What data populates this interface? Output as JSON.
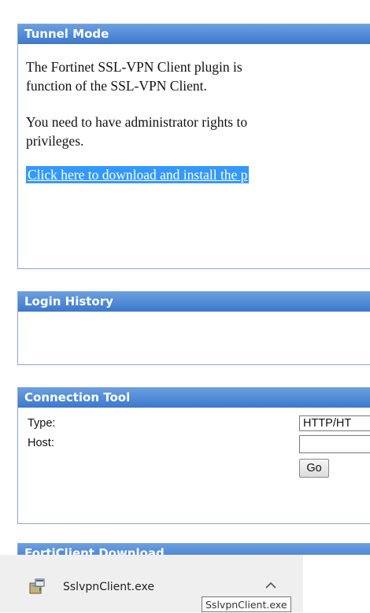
{
  "tunnel_mode": {
    "title": "Tunnel Mode",
    "line1": "The Fortinet SSL-VPN Client plugin is",
    "line2": "function of the SSL-VPN Client.",
    "line3": "You need to have administrator rights to",
    "line4": "privileges.",
    "download_link": "Click here to download and install the p"
  },
  "login_history": {
    "title": "Login History"
  },
  "connection_tool": {
    "title": "Connection Tool",
    "type_label": "Type:",
    "type_value": "HTTP/HT",
    "host_label": "Host:",
    "host_value": "",
    "go_label": "Go"
  },
  "forticlient_download": {
    "title": "FortiClient Download"
  },
  "download_bar": {
    "filename": "SslvpnClient.exe",
    "tooltip": "SslvpnClient.exe",
    "icon": "installer-package-icon",
    "chevron_icon": "chevron-up-icon"
  }
}
